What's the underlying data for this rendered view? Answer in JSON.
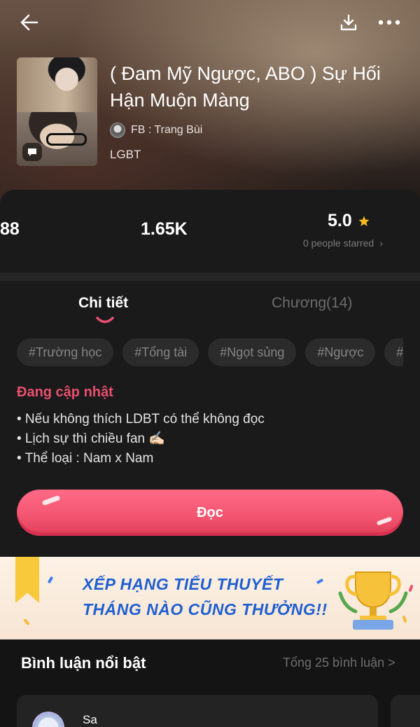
{
  "header": {
    "back_icon": "arrow-left-icon",
    "download_icon": "download-icon",
    "more_icon": "more-dots-icon"
  },
  "book": {
    "title": "( Đam Mỹ Ngược, ABO ) Sự Hối Hận Muộn Màng",
    "author": "FB : Trang Bùi",
    "genre": "LGBT"
  },
  "stats": {
    "stat1": "88",
    "stat2": "1.65K",
    "rating": "5.0",
    "rating_sub": "0 people starred",
    "star_color": "#f5b920"
  },
  "tabs": [
    {
      "label": "Chi tiết",
      "active": true
    },
    {
      "label": "Chương(14)",
      "active": false
    }
  ],
  "tags": [
    "#Trường học",
    "#Tổng tài",
    "#Ngọt sủng",
    "#Ngược",
    "#"
  ],
  "status": "Đang cập nhật",
  "description": [
    "• Nếu không thích LDBT có thể không đọc",
    "• Lịch sự thì chiều fan ✍🏻",
    "• Thể loại : Nam x Nam"
  ],
  "read_button": "Đọc",
  "banner": {
    "line1": "XẾP HẠNG TIỂU THUYẾT",
    "line2": "THÁNG NÀO CŨNG THƯỞNG!!"
  },
  "comments": {
    "title": "Bình luận nổi bật",
    "total": "Tổng 25 bình luận >",
    "first_user": "Sa"
  },
  "colors": {
    "accent": "#e9506f",
    "background": "#1a1a1a",
    "banner_text": "#1f5fd1"
  }
}
